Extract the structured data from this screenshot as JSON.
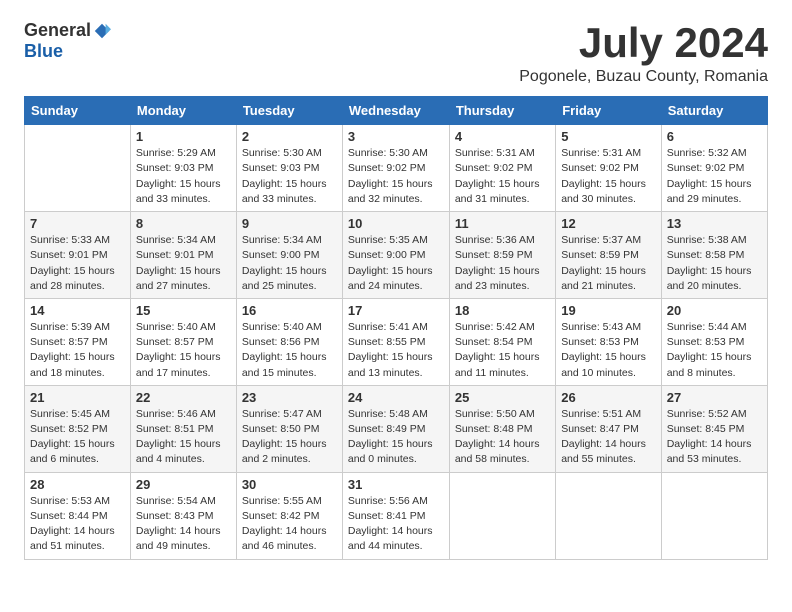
{
  "header": {
    "logo_general": "General",
    "logo_blue": "Blue",
    "month_title": "July 2024",
    "location": "Pogonele, Buzau County, Romania"
  },
  "weekdays": [
    "Sunday",
    "Monday",
    "Tuesday",
    "Wednesday",
    "Thursday",
    "Friday",
    "Saturday"
  ],
  "weeks": [
    [
      {
        "day": "",
        "info": ""
      },
      {
        "day": "1",
        "info": "Sunrise: 5:29 AM\nSunset: 9:03 PM\nDaylight: 15 hours\nand 33 minutes."
      },
      {
        "day": "2",
        "info": "Sunrise: 5:30 AM\nSunset: 9:03 PM\nDaylight: 15 hours\nand 33 minutes."
      },
      {
        "day": "3",
        "info": "Sunrise: 5:30 AM\nSunset: 9:02 PM\nDaylight: 15 hours\nand 32 minutes."
      },
      {
        "day": "4",
        "info": "Sunrise: 5:31 AM\nSunset: 9:02 PM\nDaylight: 15 hours\nand 31 minutes."
      },
      {
        "day": "5",
        "info": "Sunrise: 5:31 AM\nSunset: 9:02 PM\nDaylight: 15 hours\nand 30 minutes."
      },
      {
        "day": "6",
        "info": "Sunrise: 5:32 AM\nSunset: 9:02 PM\nDaylight: 15 hours\nand 29 minutes."
      }
    ],
    [
      {
        "day": "7",
        "info": "Sunrise: 5:33 AM\nSunset: 9:01 PM\nDaylight: 15 hours\nand 28 minutes."
      },
      {
        "day": "8",
        "info": "Sunrise: 5:34 AM\nSunset: 9:01 PM\nDaylight: 15 hours\nand 27 minutes."
      },
      {
        "day": "9",
        "info": "Sunrise: 5:34 AM\nSunset: 9:00 PM\nDaylight: 15 hours\nand 25 minutes."
      },
      {
        "day": "10",
        "info": "Sunrise: 5:35 AM\nSunset: 9:00 PM\nDaylight: 15 hours\nand 24 minutes."
      },
      {
        "day": "11",
        "info": "Sunrise: 5:36 AM\nSunset: 8:59 PM\nDaylight: 15 hours\nand 23 minutes."
      },
      {
        "day": "12",
        "info": "Sunrise: 5:37 AM\nSunset: 8:59 PM\nDaylight: 15 hours\nand 21 minutes."
      },
      {
        "day": "13",
        "info": "Sunrise: 5:38 AM\nSunset: 8:58 PM\nDaylight: 15 hours\nand 20 minutes."
      }
    ],
    [
      {
        "day": "14",
        "info": "Sunrise: 5:39 AM\nSunset: 8:57 PM\nDaylight: 15 hours\nand 18 minutes."
      },
      {
        "day": "15",
        "info": "Sunrise: 5:40 AM\nSunset: 8:57 PM\nDaylight: 15 hours\nand 17 minutes."
      },
      {
        "day": "16",
        "info": "Sunrise: 5:40 AM\nSunset: 8:56 PM\nDaylight: 15 hours\nand 15 minutes."
      },
      {
        "day": "17",
        "info": "Sunrise: 5:41 AM\nSunset: 8:55 PM\nDaylight: 15 hours\nand 13 minutes."
      },
      {
        "day": "18",
        "info": "Sunrise: 5:42 AM\nSunset: 8:54 PM\nDaylight: 15 hours\nand 11 minutes."
      },
      {
        "day": "19",
        "info": "Sunrise: 5:43 AM\nSunset: 8:53 PM\nDaylight: 15 hours\nand 10 minutes."
      },
      {
        "day": "20",
        "info": "Sunrise: 5:44 AM\nSunset: 8:53 PM\nDaylight: 15 hours\nand 8 minutes."
      }
    ],
    [
      {
        "day": "21",
        "info": "Sunrise: 5:45 AM\nSunset: 8:52 PM\nDaylight: 15 hours\nand 6 minutes."
      },
      {
        "day": "22",
        "info": "Sunrise: 5:46 AM\nSunset: 8:51 PM\nDaylight: 15 hours\nand 4 minutes."
      },
      {
        "day": "23",
        "info": "Sunrise: 5:47 AM\nSunset: 8:50 PM\nDaylight: 15 hours\nand 2 minutes."
      },
      {
        "day": "24",
        "info": "Sunrise: 5:48 AM\nSunset: 8:49 PM\nDaylight: 15 hours\nand 0 minutes."
      },
      {
        "day": "25",
        "info": "Sunrise: 5:50 AM\nSunset: 8:48 PM\nDaylight: 14 hours\nand 58 minutes."
      },
      {
        "day": "26",
        "info": "Sunrise: 5:51 AM\nSunset: 8:47 PM\nDaylight: 14 hours\nand 55 minutes."
      },
      {
        "day": "27",
        "info": "Sunrise: 5:52 AM\nSunset: 8:45 PM\nDaylight: 14 hours\nand 53 minutes."
      }
    ],
    [
      {
        "day": "28",
        "info": "Sunrise: 5:53 AM\nSunset: 8:44 PM\nDaylight: 14 hours\nand 51 minutes."
      },
      {
        "day": "29",
        "info": "Sunrise: 5:54 AM\nSunset: 8:43 PM\nDaylight: 14 hours\nand 49 minutes."
      },
      {
        "day": "30",
        "info": "Sunrise: 5:55 AM\nSunset: 8:42 PM\nDaylight: 14 hours\nand 46 minutes."
      },
      {
        "day": "31",
        "info": "Sunrise: 5:56 AM\nSunset: 8:41 PM\nDaylight: 14 hours\nand 44 minutes."
      },
      {
        "day": "",
        "info": ""
      },
      {
        "day": "",
        "info": ""
      },
      {
        "day": "",
        "info": ""
      }
    ]
  ]
}
